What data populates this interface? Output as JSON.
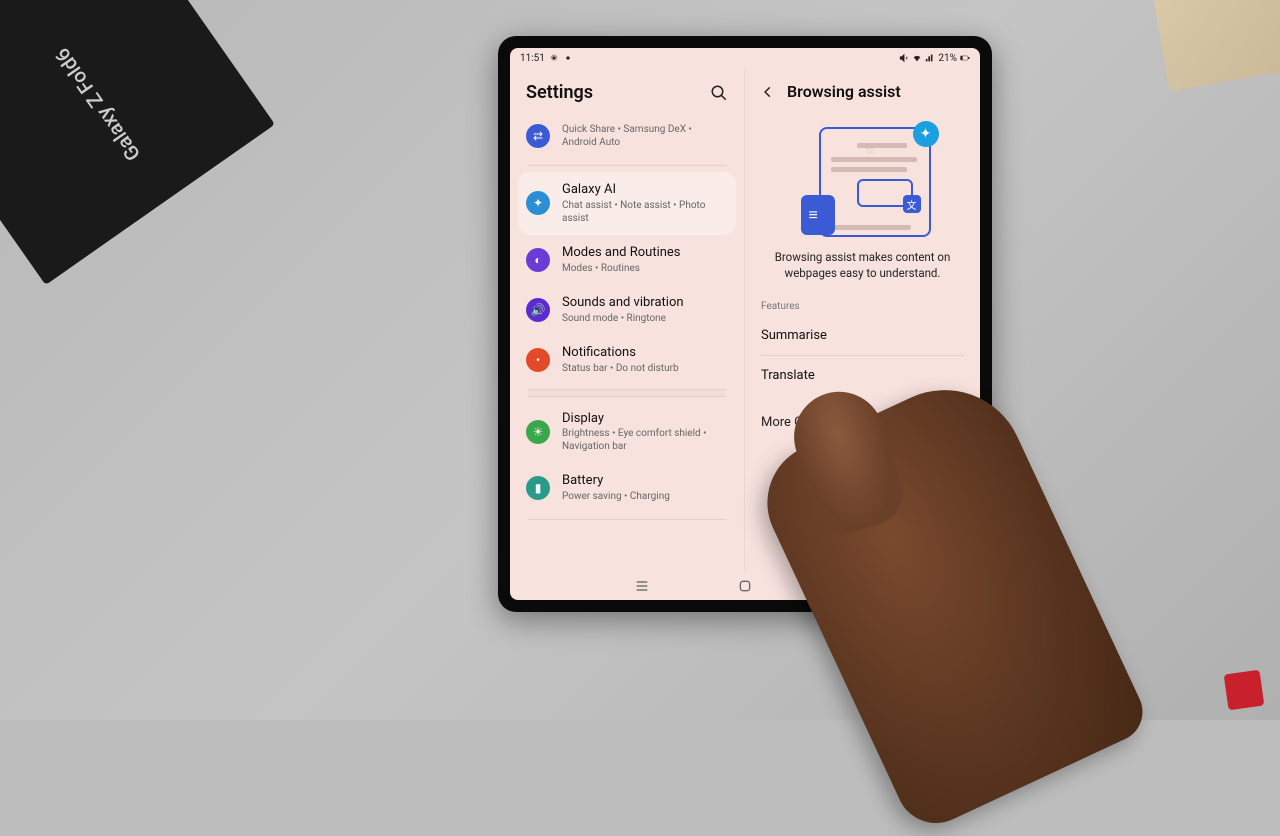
{
  "status": {
    "time": "11:51",
    "battery_text": "21%"
  },
  "left": {
    "title": "Settings",
    "items": [
      {
        "title": "",
        "sub": "Quick Share  •  Samsung DeX  •  Android Auto",
        "icon_bg": "#3b5bd6",
        "glyph": "⇄",
        "divider_after": true
      },
      {
        "title": "Galaxy AI",
        "sub": "Chat assist  •  Note assist  •  Photo assist",
        "icon_bg": "#2a8fd6",
        "glyph": "✦",
        "selected": true
      },
      {
        "title": "Modes and Routines",
        "sub": "Modes  •  Routines",
        "icon_bg": "#6a3bd6",
        "glyph": "◐"
      },
      {
        "title": "Sounds and vibration",
        "sub": "Sound mode  •  Ringtone",
        "icon_bg": "#5a2bd0",
        "glyph": "🔊"
      },
      {
        "title": "Notifications",
        "sub": "Status bar  •  Do not disturb",
        "icon_bg": "#e24a2a",
        "glyph": "•",
        "gap_after": true
      },
      {
        "title": "Display",
        "sub": "Brightness  •  Eye comfort shield  •  Navigation bar",
        "icon_bg": "#3aa84a",
        "glyph": "☀"
      },
      {
        "title": "Battery",
        "sub": "Power saving  •  Charging",
        "icon_bg": "#2a9a8a",
        "glyph": "▮",
        "divider_after": true
      }
    ]
  },
  "right": {
    "title": "Browsing assist",
    "hero_text": "Browsing assist makes content on webpages easy to understand.",
    "features_header": "Features",
    "features": [
      "Summarise",
      "Translate"
    ],
    "more": "More Galaxy AI features"
  },
  "box_label": "Galaxy Z Fold6"
}
